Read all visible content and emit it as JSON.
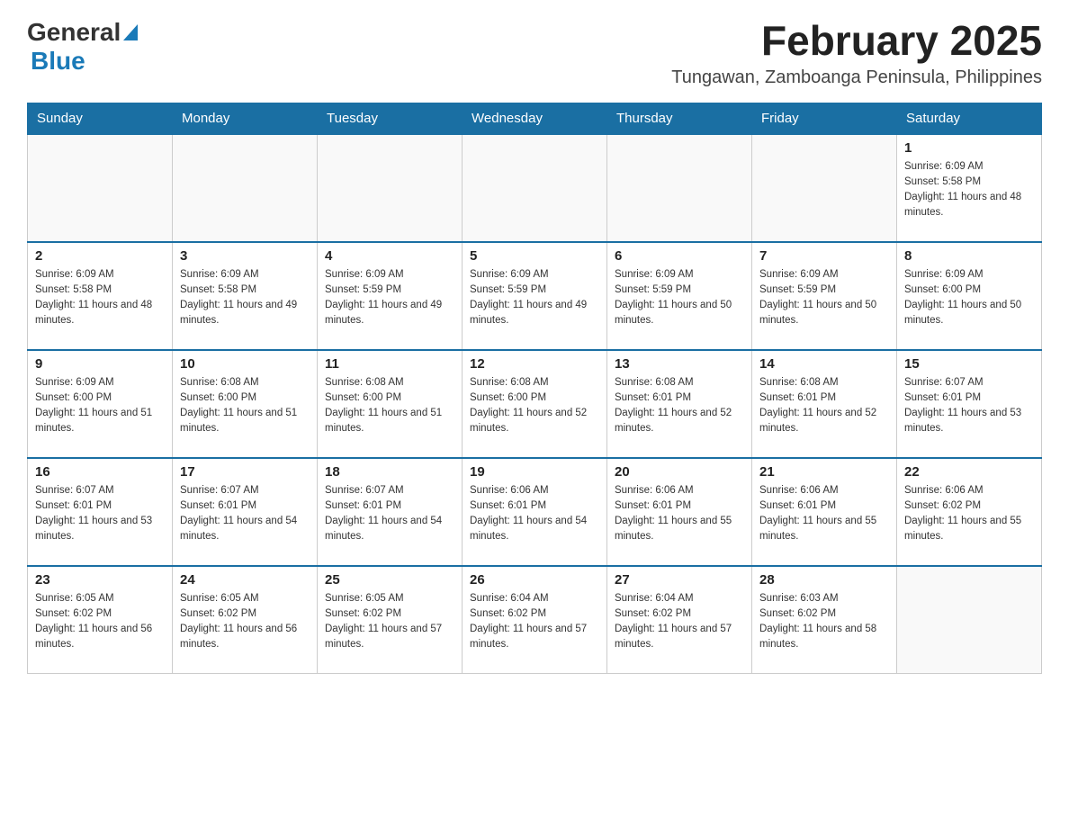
{
  "header": {
    "logo_general": "General",
    "logo_blue": "Blue",
    "month_year": "February 2025",
    "location": "Tungawan, Zamboanga Peninsula, Philippines"
  },
  "weekdays": [
    "Sunday",
    "Monday",
    "Tuesday",
    "Wednesday",
    "Thursday",
    "Friday",
    "Saturday"
  ],
  "weeks": [
    [
      {
        "day": "",
        "sunrise": "",
        "sunset": "",
        "daylight": ""
      },
      {
        "day": "",
        "sunrise": "",
        "sunset": "",
        "daylight": ""
      },
      {
        "day": "",
        "sunrise": "",
        "sunset": "",
        "daylight": ""
      },
      {
        "day": "",
        "sunrise": "",
        "sunset": "",
        "daylight": ""
      },
      {
        "day": "",
        "sunrise": "",
        "sunset": "",
        "daylight": ""
      },
      {
        "day": "",
        "sunrise": "",
        "sunset": "",
        "daylight": ""
      },
      {
        "day": "1",
        "sunrise": "Sunrise: 6:09 AM",
        "sunset": "Sunset: 5:58 PM",
        "daylight": "Daylight: 11 hours and 48 minutes."
      }
    ],
    [
      {
        "day": "2",
        "sunrise": "Sunrise: 6:09 AM",
        "sunset": "Sunset: 5:58 PM",
        "daylight": "Daylight: 11 hours and 48 minutes."
      },
      {
        "day": "3",
        "sunrise": "Sunrise: 6:09 AM",
        "sunset": "Sunset: 5:58 PM",
        "daylight": "Daylight: 11 hours and 49 minutes."
      },
      {
        "day": "4",
        "sunrise": "Sunrise: 6:09 AM",
        "sunset": "Sunset: 5:59 PM",
        "daylight": "Daylight: 11 hours and 49 minutes."
      },
      {
        "day": "5",
        "sunrise": "Sunrise: 6:09 AM",
        "sunset": "Sunset: 5:59 PM",
        "daylight": "Daylight: 11 hours and 49 minutes."
      },
      {
        "day": "6",
        "sunrise": "Sunrise: 6:09 AM",
        "sunset": "Sunset: 5:59 PM",
        "daylight": "Daylight: 11 hours and 50 minutes."
      },
      {
        "day": "7",
        "sunrise": "Sunrise: 6:09 AM",
        "sunset": "Sunset: 5:59 PM",
        "daylight": "Daylight: 11 hours and 50 minutes."
      },
      {
        "day": "8",
        "sunrise": "Sunrise: 6:09 AM",
        "sunset": "Sunset: 6:00 PM",
        "daylight": "Daylight: 11 hours and 50 minutes."
      }
    ],
    [
      {
        "day": "9",
        "sunrise": "Sunrise: 6:09 AM",
        "sunset": "Sunset: 6:00 PM",
        "daylight": "Daylight: 11 hours and 51 minutes."
      },
      {
        "day": "10",
        "sunrise": "Sunrise: 6:08 AM",
        "sunset": "Sunset: 6:00 PM",
        "daylight": "Daylight: 11 hours and 51 minutes."
      },
      {
        "day": "11",
        "sunrise": "Sunrise: 6:08 AM",
        "sunset": "Sunset: 6:00 PM",
        "daylight": "Daylight: 11 hours and 51 minutes."
      },
      {
        "day": "12",
        "sunrise": "Sunrise: 6:08 AM",
        "sunset": "Sunset: 6:00 PM",
        "daylight": "Daylight: 11 hours and 52 minutes."
      },
      {
        "day": "13",
        "sunrise": "Sunrise: 6:08 AM",
        "sunset": "Sunset: 6:01 PM",
        "daylight": "Daylight: 11 hours and 52 minutes."
      },
      {
        "day": "14",
        "sunrise": "Sunrise: 6:08 AM",
        "sunset": "Sunset: 6:01 PM",
        "daylight": "Daylight: 11 hours and 52 minutes."
      },
      {
        "day": "15",
        "sunrise": "Sunrise: 6:07 AM",
        "sunset": "Sunset: 6:01 PM",
        "daylight": "Daylight: 11 hours and 53 minutes."
      }
    ],
    [
      {
        "day": "16",
        "sunrise": "Sunrise: 6:07 AM",
        "sunset": "Sunset: 6:01 PM",
        "daylight": "Daylight: 11 hours and 53 minutes."
      },
      {
        "day": "17",
        "sunrise": "Sunrise: 6:07 AM",
        "sunset": "Sunset: 6:01 PM",
        "daylight": "Daylight: 11 hours and 54 minutes."
      },
      {
        "day": "18",
        "sunrise": "Sunrise: 6:07 AM",
        "sunset": "Sunset: 6:01 PM",
        "daylight": "Daylight: 11 hours and 54 minutes."
      },
      {
        "day": "19",
        "sunrise": "Sunrise: 6:06 AM",
        "sunset": "Sunset: 6:01 PM",
        "daylight": "Daylight: 11 hours and 54 minutes."
      },
      {
        "day": "20",
        "sunrise": "Sunrise: 6:06 AM",
        "sunset": "Sunset: 6:01 PM",
        "daylight": "Daylight: 11 hours and 55 minutes."
      },
      {
        "day": "21",
        "sunrise": "Sunrise: 6:06 AM",
        "sunset": "Sunset: 6:01 PM",
        "daylight": "Daylight: 11 hours and 55 minutes."
      },
      {
        "day": "22",
        "sunrise": "Sunrise: 6:06 AM",
        "sunset": "Sunset: 6:02 PM",
        "daylight": "Daylight: 11 hours and 55 minutes."
      }
    ],
    [
      {
        "day": "23",
        "sunrise": "Sunrise: 6:05 AM",
        "sunset": "Sunset: 6:02 PM",
        "daylight": "Daylight: 11 hours and 56 minutes."
      },
      {
        "day": "24",
        "sunrise": "Sunrise: 6:05 AM",
        "sunset": "Sunset: 6:02 PM",
        "daylight": "Daylight: 11 hours and 56 minutes."
      },
      {
        "day": "25",
        "sunrise": "Sunrise: 6:05 AM",
        "sunset": "Sunset: 6:02 PM",
        "daylight": "Daylight: 11 hours and 57 minutes."
      },
      {
        "day": "26",
        "sunrise": "Sunrise: 6:04 AM",
        "sunset": "Sunset: 6:02 PM",
        "daylight": "Daylight: 11 hours and 57 minutes."
      },
      {
        "day": "27",
        "sunrise": "Sunrise: 6:04 AM",
        "sunset": "Sunset: 6:02 PM",
        "daylight": "Daylight: 11 hours and 57 minutes."
      },
      {
        "day": "28",
        "sunrise": "Sunrise: 6:03 AM",
        "sunset": "Sunset: 6:02 PM",
        "daylight": "Daylight: 11 hours and 58 minutes."
      },
      {
        "day": "",
        "sunrise": "",
        "sunset": "",
        "daylight": ""
      }
    ]
  ]
}
